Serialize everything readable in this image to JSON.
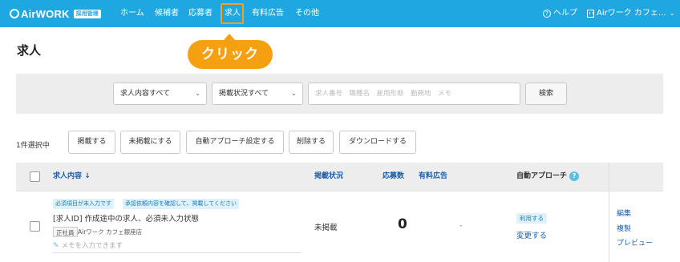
{
  "header": {
    "logo_text": "AirWORK",
    "logo_badge": "採用管理",
    "nav": [
      {
        "label": "ホーム"
      },
      {
        "label": "候補者"
      },
      {
        "label": "応募者"
      },
      {
        "label": "求人"
      },
      {
        "label": "有料広告"
      },
      {
        "label": "その他"
      }
    ],
    "active_nav": "求人",
    "help_label": "ヘルプ",
    "account_label": "Airワーク カフェ…",
    "accent_color": "#1ea7e1"
  },
  "page": {
    "title": "求人",
    "callout": "クリック",
    "callout_color": "#f5a010"
  },
  "filters": {
    "content_select": "求人内容すべて",
    "status_select": "掲載状況すべて",
    "search_placeholder": "求人番号　職種名　雇用形態　勤務地　メモ",
    "search_button": "検索"
  },
  "actions": {
    "selected_count": "1件選択中",
    "publish": "掲載する",
    "unpublish": "未掲載にする",
    "auto_approach": "自動アプローチ設定する",
    "delete": "削除する",
    "download": "ダウンロードする"
  },
  "table": {
    "headers": {
      "content": "求人内容 ↓",
      "status": "掲載状況",
      "applicants": "応募数",
      "paid_ad": "有料広告",
      "auto_approach": "自動アプローチ"
    },
    "rows": [
      {
        "tags": [
          "必須項目が未入力です",
          "承認依頼内容を確認して、掲載してください"
        ],
        "title": "[求人ID] 作成途中の求人、必須未入力状態",
        "employment_type": "正社員",
        "shop": "Airワーク カフェ銀座店",
        "memo_placeholder": "メモを入力できます",
        "status": "未掲載",
        "applicant_count": "0",
        "paid_ad": "-",
        "auto_approach_badge": "利用する",
        "auto_approach_link": "変更する",
        "links": {
          "edit": "編集",
          "copy": "複製",
          "preview": "プレビュー"
        }
      }
    ]
  }
}
